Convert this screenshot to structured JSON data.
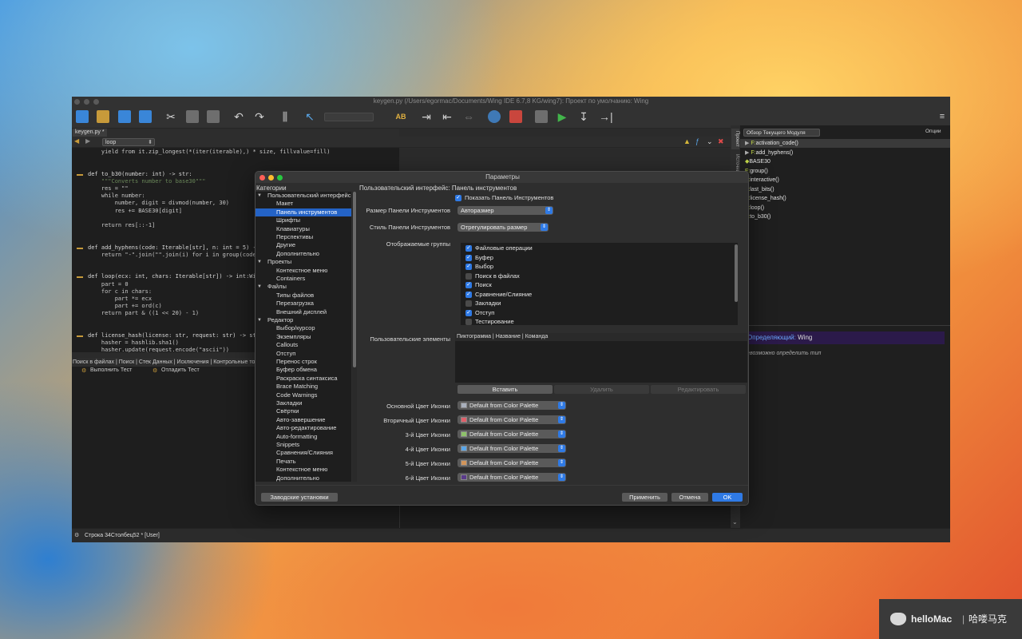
{
  "ide": {
    "window_title": "keygen.py (/Users/egormac/Documents/Wing IDE 6.7,8 KG/wing7): Проект по умолчанию: Wing",
    "file_tab": "keygen.py *",
    "scope_select": "loop",
    "code_lines": [
      "    yield from it.zip_longest(*(iter(iterable),) * size, fillvalue=fill)",
      "",
      "",
      "def to_b30(number: int) -> str:",
      "    \"\"\"Converts number to base30\"\"\"",
      "    res = \"\"",
      "    while number:",
      "        number, digit = divmod(number, 30)",
      "        res += BASE30[digit]",
      "",
      "    return res[::-1]",
      "",
      "",
      "def add_hyphens(code: Iterable[str], n: int = 5) -> str:",
      "    return \"-\".join(\"\".join(i) for i in group(code,",
      "",
      "",
      "def loop(ecx: int, chars: Iterable[str]) -> int:Wi",
      "    part = 0",
      "    for c in chars:",
      "        part *= ecx",
      "        part += ord(c)",
      "    return part & ((1 << 20) - 1)",
      "",
      "",
      "def license_hash(license: str, request: str) -> st",
      "    hasher = hashlib.sha1()",
      "    hasher.update(request.encode(\"ascii\"))"
    ],
    "bottom_tabs": "Поиск в файлах | Поиск | Стек Данных | Исключения | Контрольные точки",
    "bottom_run_test": "Выполнить Тест",
    "bottom_debug_test": "Отладить Тест",
    "status_text": "Строка 34Столбец52 * [User]",
    "side_tab_project": "Проект",
    "side_tab_source": "Источник",
    "outline_select": "Обзор Текущего Модуля",
    "outline_options": "Опции",
    "outline_items": [
      {
        "prefix": "F:",
        "name": "activation_code()"
      },
      {
        "prefix": "F:",
        "name": "add_hyphens()"
      },
      {
        "prefix": "◆",
        "name": "BASE30"
      },
      {
        "prefix": "F:",
        "name": "group()"
      },
      {
        "prefix": "F:",
        "name": "interactive()"
      },
      {
        "prefix": "F:",
        "name": "last_bits()"
      },
      {
        "prefix": "F:",
        "name": "license_hash()"
      },
      {
        "prefix": "F:",
        "name": "loop()"
      },
      {
        "prefix": "F:",
        "name": "to_b30()"
      }
    ],
    "defining_label": "Определяющий:",
    "defining_value": "Wing",
    "cannot_determine": "Невозможно определить тип"
  },
  "dialog": {
    "title": "Параметры",
    "categories_header": "Категории",
    "pane_header": "Пользовательский интерфейс: Панель инструментов",
    "categories": [
      {
        "label": "Пользовательский интерфейс",
        "level": 0,
        "selected": false
      },
      {
        "label": "Макет",
        "level": 1,
        "selected": false
      },
      {
        "label": "Панель инструментов",
        "level": 1,
        "selected": true
      },
      {
        "label": "Шрифты",
        "level": 1,
        "selected": false
      },
      {
        "label": "Клавиатуры",
        "level": 1,
        "selected": false
      },
      {
        "label": "Перспективы",
        "level": 1,
        "selected": false
      },
      {
        "label": "Другие",
        "level": 1,
        "selected": false
      },
      {
        "label": "Дополнительно",
        "level": 1,
        "selected": false
      },
      {
        "label": "Проекты",
        "level": 0,
        "selected": false
      },
      {
        "label": "Контекстное меню",
        "level": 1,
        "selected": false
      },
      {
        "label": "Containers",
        "level": 1,
        "selected": false
      },
      {
        "label": "Файлы",
        "level": 0,
        "selected": false
      },
      {
        "label": "Типы файлов",
        "level": 1,
        "selected": false
      },
      {
        "label": "Перезагрузка",
        "level": 1,
        "selected": false
      },
      {
        "label": "Внешний дисплей",
        "level": 1,
        "selected": false
      },
      {
        "label": "Редактор",
        "level": 0,
        "selected": false
      },
      {
        "label": "Выбор/курсор",
        "level": 1,
        "selected": false
      },
      {
        "label": "Экземпляры",
        "level": 1,
        "selected": false
      },
      {
        "label": "Callouts",
        "level": 1,
        "selected": false
      },
      {
        "label": "Отступ",
        "level": 1,
        "selected": false
      },
      {
        "label": "Перенос строк",
        "level": 1,
        "selected": false
      },
      {
        "label": "Буфер обмена",
        "level": 1,
        "selected": false
      },
      {
        "label": "Раскраска синтаксиса",
        "level": 1,
        "selected": false
      },
      {
        "label": "Brace Matching",
        "level": 1,
        "selected": false
      },
      {
        "label": "Code Warnings",
        "level": 1,
        "selected": false
      },
      {
        "label": "Закладки",
        "level": 1,
        "selected": false
      },
      {
        "label": "Свёртки",
        "level": 1,
        "selected": false
      },
      {
        "label": "Авто-завершение",
        "level": 1,
        "selected": false
      },
      {
        "label": "Авто-редактирование",
        "level": 1,
        "selected": false
      },
      {
        "label": "Auto-formatting",
        "level": 1,
        "selected": false
      },
      {
        "label": "Snippets",
        "level": 1,
        "selected": false
      },
      {
        "label": "Сравнения/Слияния",
        "level": 1,
        "selected": false
      },
      {
        "label": "Печать",
        "level": 1,
        "selected": false
      },
      {
        "label": "Контекстное меню",
        "level": 1,
        "selected": false
      },
      {
        "label": "Дополнительно",
        "level": 1,
        "selected": false
      }
    ],
    "show_toolbar": {
      "label": "Показать Панель Инструментов",
      "checked": true
    },
    "toolbar_size": {
      "label": "Размер Панели Инструментов",
      "value": "Авторазмер"
    },
    "toolbar_style": {
      "label": "Стиль Панели Инструментов",
      "value": "Отрегулировать размер"
    },
    "groups_label": "Отображаемые группы",
    "groups": [
      {
        "label": "Файловые операции",
        "checked": true
      },
      {
        "label": "Буфер",
        "checked": true
      },
      {
        "label": "Выбор",
        "checked": true
      },
      {
        "label": "Поиск в файлах",
        "checked": false
      },
      {
        "label": "Поиск",
        "checked": true
      },
      {
        "label": "Сравнение/Слияние",
        "checked": true
      },
      {
        "label": "Закладки",
        "checked": false
      },
      {
        "label": "Отступ",
        "checked": true
      },
      {
        "label": "Тестирование",
        "checked": false
      }
    ],
    "custom_label": "Пользовательские элементы",
    "custom_columns": [
      "Пиктограмма",
      "Название",
      "Команда"
    ],
    "btn_insert": "Вставить",
    "btn_delete": "Удалить",
    "btn_edit": "Редактировать",
    "colors": [
      {
        "label": "Основной Цвет Иконки",
        "value": "Default from Color Palette",
        "swatch": "#a9b0bd"
      },
      {
        "label": "Вторичный Цвет Иконки",
        "value": "Default from Color Palette",
        "swatch": "#e0606a"
      },
      {
        "label": "3-й Цвет Иконки",
        "value": "Default from Color Palette",
        "swatch": "#8ec26a"
      },
      {
        "label": "4-й Цвет Иконки",
        "value": "Default from Color Palette",
        "swatch": "#5aa6e8"
      },
      {
        "label": "5-й Цвет Иконки",
        "value": "Default from Color Palette",
        "swatch": "#d2955a"
      },
      {
        "label": "6-й Цвет Иконки",
        "value": "Default from Color Palette",
        "swatch": "#5a3a8a"
      }
    ],
    "btn_defaults": "Заводские установки",
    "btn_apply": "Применить",
    "btn_cancel": "Отмена",
    "btn_ok": "OK"
  },
  "watermark": {
    "brand": "helloMac",
    "cn": "哈喽马克"
  },
  "colors": {
    "accent": "#2f7ae5",
    "selection": "#2463c6",
    "ok_button": "#2f7ae5"
  }
}
